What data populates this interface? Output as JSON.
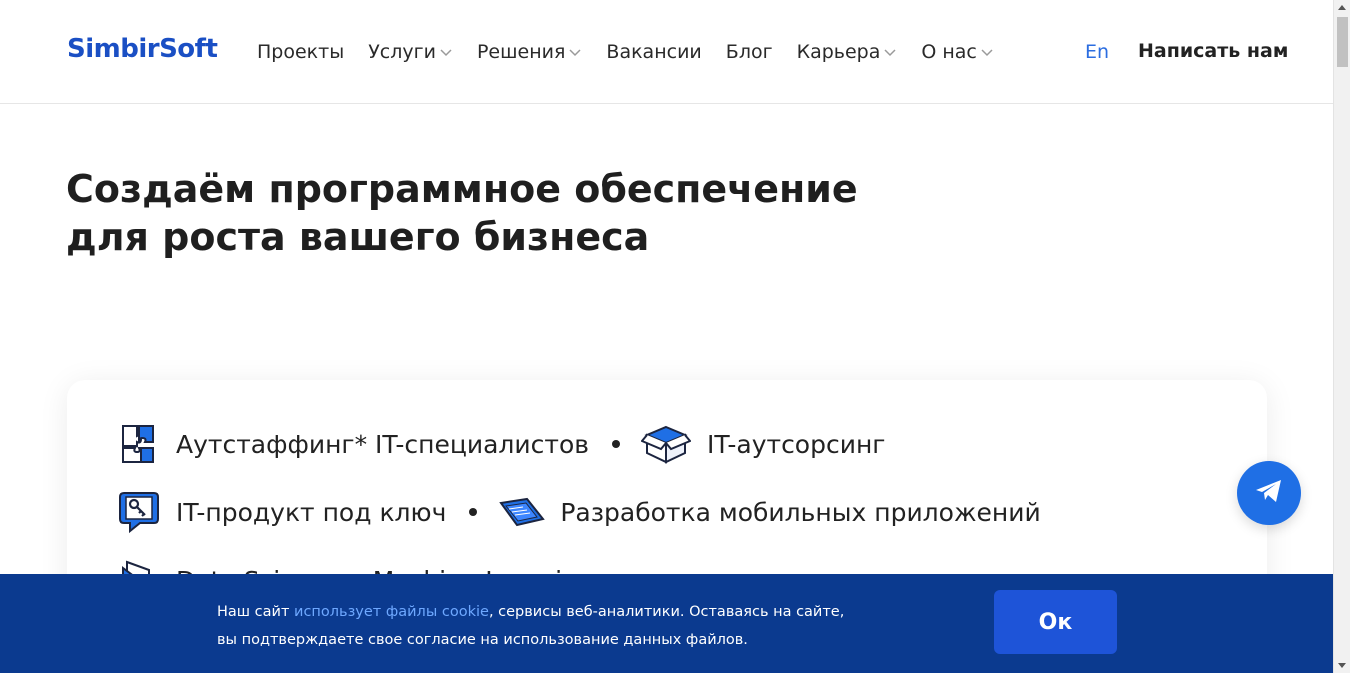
{
  "header": {
    "logo": "SimbirSoft",
    "nav": [
      {
        "label": "Проекты",
        "dropdown": false
      },
      {
        "label": "Услуги",
        "dropdown": true
      },
      {
        "label": "Решения",
        "dropdown": true
      },
      {
        "label": "Вакансии",
        "dropdown": false
      },
      {
        "label": "Блог",
        "dropdown": false
      },
      {
        "label": "Карьера",
        "dropdown": true
      },
      {
        "label": "О нас",
        "dropdown": true
      }
    ],
    "language": "En",
    "contact_label": "Написать нам"
  },
  "hero": {
    "title_line1": "Создаём программное обеспечение",
    "title_line2": "для роста вашего бизнеса"
  },
  "services": [
    {
      "label": "Аутстаффинг* IT-специалистов",
      "icon": "puzzle-icon"
    },
    {
      "label": "IT-аутсорсинг",
      "icon": "box-icon"
    },
    {
      "label": "IT-продукт под ключ",
      "icon": "key-chat-icon"
    },
    {
      "label": "Разработка мобильных приложений",
      "icon": "phone-icon"
    },
    {
      "label": "Data Science и Machine Learning",
      "icon": "data-icon"
    }
  ],
  "cookie": {
    "text_before": "Наш сайт ",
    "link": "использует файлы cookie",
    "text_after": ", сервисы веб-аналитики. Оставаясь на сайте,",
    "line2": "вы подтверждаете свое согласие на использование данных файлов.",
    "ok_label": "Ок"
  },
  "colors": {
    "brand": "#1a4fc4",
    "accent": "#1f6fe5",
    "cookie_bg": "#0b3a8f",
    "ok_button": "#1e54d8"
  }
}
